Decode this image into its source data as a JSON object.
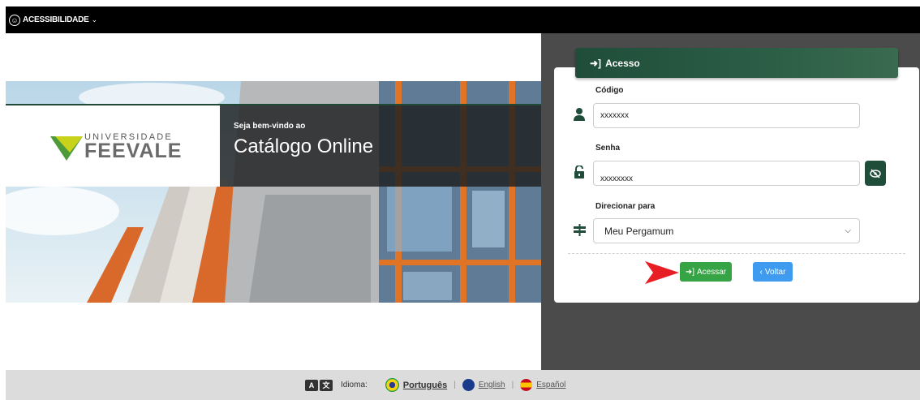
{
  "topbar": {
    "accessibility_label": "ACESSIBILIDADE",
    "accessibility_icon": "accessibility-icon",
    "chevron": "⌄"
  },
  "brand": {
    "line1": "UNIVERSIDADE",
    "line2": "FEEVALE"
  },
  "welcome": {
    "small": "Seja bem-vindo ao",
    "big": "Catálogo Online"
  },
  "login": {
    "header": "Acesso",
    "code_label": "Código",
    "code_value": "xxxxxxx",
    "password_label": "Senha",
    "password_value": "xxxxxxxx",
    "redirect_label": "Direcionar para",
    "redirect_value": "Meu Pergamum",
    "submit_label": "Acessar",
    "back_label": "Voltar"
  },
  "footer": {
    "language_label": "Idioma:",
    "languages": [
      "Português",
      "English",
      "Español"
    ],
    "active_language": "Português"
  },
  "colors": {
    "brand_green": "#1f4d3a",
    "submit_green": "#36a344",
    "back_blue": "#3f9bf0"
  }
}
